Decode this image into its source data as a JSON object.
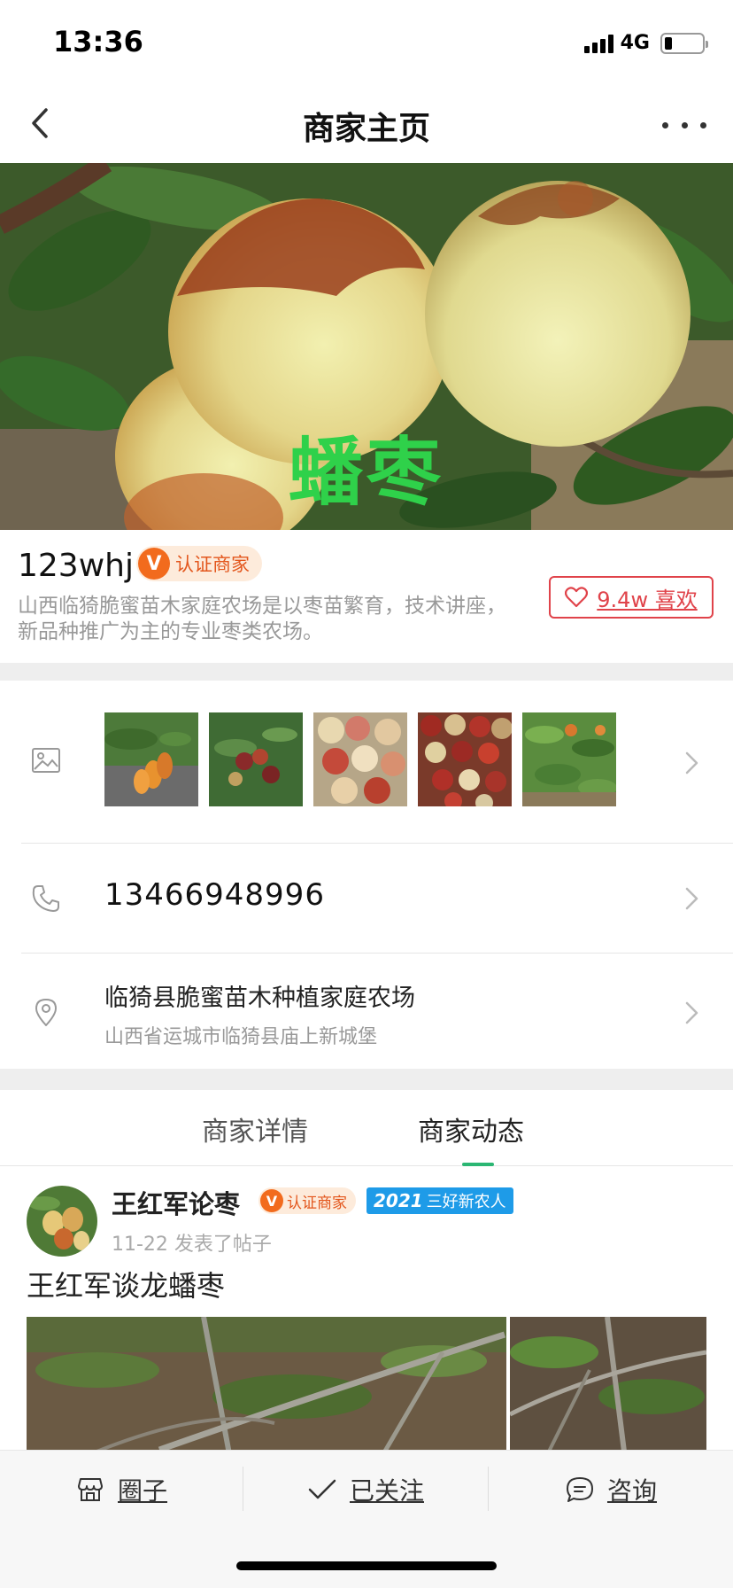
{
  "status_bar": {
    "time": "13:36",
    "network": "4G",
    "battery_level": 0.2
  },
  "nav": {
    "title": "商家主页",
    "back_icon": "chevron-left-icon",
    "more_icon": "more-dots-icon"
  },
  "hero": {
    "caption": "蟠枣"
  },
  "merchant": {
    "name": "123whj",
    "cert_mark": "V",
    "cert_label": "认证商家",
    "description": "山西临猗脆蜜苗木家庭农场是以枣苗繁育，技术讲座，新品种推广为主的专业枣类农场。",
    "like_label": "9.4w 喜欢",
    "like_icon": "heart-outline-icon"
  },
  "gallery": {
    "icon": "image-icon",
    "thumbnail_count": 5
  },
  "contact": {
    "phone_icon": "phone-icon",
    "phone": "13466948996"
  },
  "address": {
    "icon": "location-pin-icon",
    "name": "临猗县脆蜜苗木种植家庭农场",
    "detail": "山西省运城市临猗县庙上新城堡"
  },
  "tabs": {
    "details": "商家详情",
    "activity": "商家动态",
    "active": "商家动态",
    "accent_color": "#2bb673"
  },
  "post": {
    "author": "王红军论枣",
    "cert_mark": "V",
    "cert_label": "认证商家",
    "award_year": "2021",
    "award_label": "三好新农人",
    "meta": "11-22 发表了帖子",
    "title": "王红军谈龙蟠枣"
  },
  "bottom_bar": {
    "circle_label": "圈子",
    "circle_icon": "store-icon",
    "follow_label": "已关注",
    "follow_icon": "checkmark-icon",
    "consult_label": "咨询",
    "consult_icon": "chat-bubble-icon"
  },
  "colors": {
    "cert_orange": "#f26b1d",
    "like_red": "#e0434a",
    "award_blue": "#1e9be8",
    "caption_green": "#2fd14a"
  }
}
